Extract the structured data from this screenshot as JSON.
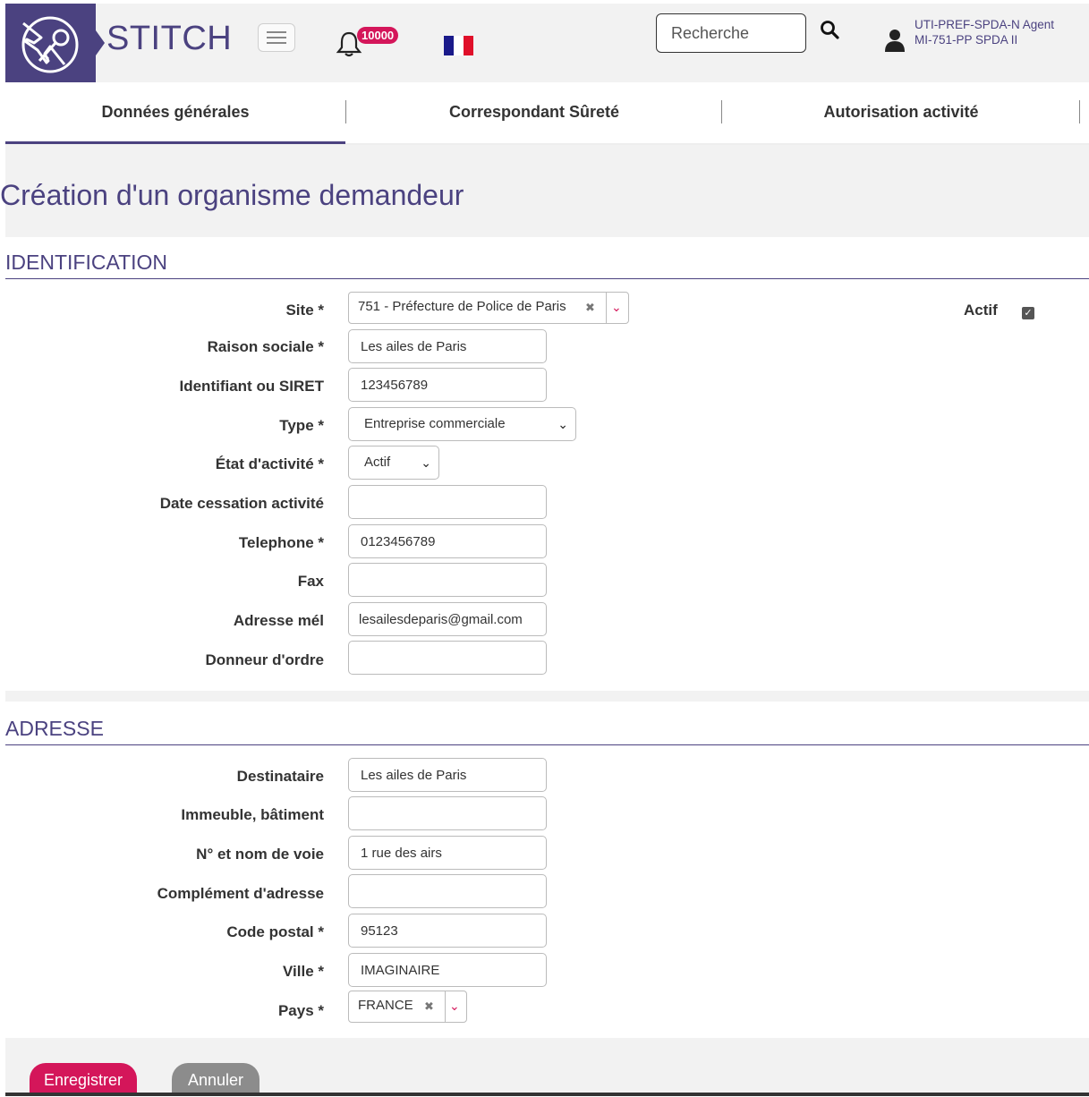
{
  "header": {
    "app_name": "STITCH",
    "notification_count": "10000",
    "search_placeholder": "Recherche",
    "user_line1": "UTI-PREF-SPDA-N Agent",
    "user_line2": "MI-751-PP SPDA II"
  },
  "tabs": [
    {
      "label": "Données générales"
    },
    {
      "label": "Correspondant Sûreté"
    },
    {
      "label": "Autorisation activité"
    }
  ],
  "page_title": "Création d'un organisme demandeur",
  "identification": {
    "title": "IDENTIFICATION",
    "site_label": "Site *",
    "site_value": "751 - Préfecture de Police de Paris",
    "actif_label": "Actif",
    "actif_checked": true,
    "raison_label": "Raison sociale *",
    "raison_value": "Les ailes de Paris",
    "siret_label": "Identifiant ou SIRET",
    "siret_value": "123456789",
    "type_label": "Type *",
    "type_value": "Entreprise commerciale",
    "etat_label": "État d'activité *",
    "etat_value": "Actif",
    "date_label": "Date cessation activité",
    "date_value": "",
    "tel_label": "Telephone *",
    "tel_value": "0123456789",
    "fax_label": "Fax",
    "fax_value": "",
    "mel_label": "Adresse mél",
    "mel_value": "lesailesdeparis@gmail.com",
    "donneur_label": "Donneur d'ordre",
    "donneur_value": ""
  },
  "adresse": {
    "title": "ADRESSE",
    "dest_label": "Destinataire",
    "dest_value": "Les ailes de Paris",
    "imm_label": "Immeuble, bâtiment",
    "imm_value": "",
    "voie_label": "N° et nom de voie",
    "voie_value": "1 rue des airs",
    "comp_label": "Complément d'adresse",
    "comp_value": "",
    "cp_label": "Code postal *",
    "cp_value": "95123",
    "ville_label": "Ville *",
    "ville_value": "IMAGINAIRE",
    "pays_label": "Pays *",
    "pays_value": "FRANCE"
  },
  "actions": {
    "save": "Enregistrer",
    "cancel": "Annuler"
  },
  "colors": {
    "brand": "#4b4280",
    "accent": "#d4165a",
    "cancel": "#8c8c8c"
  }
}
